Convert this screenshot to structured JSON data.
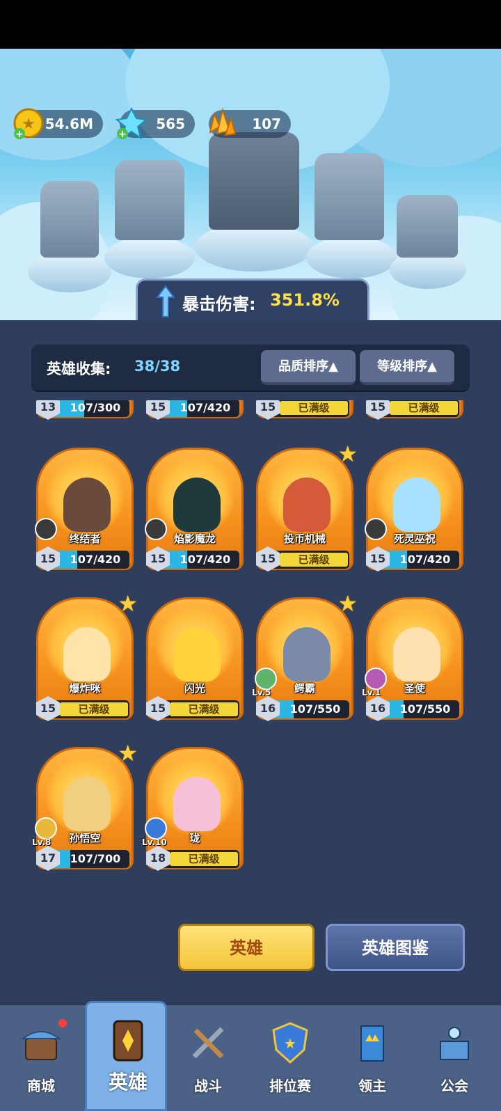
{
  "resources": {
    "gold": "54.6M",
    "crystal": "565",
    "gem": "107"
  },
  "crit": {
    "label": "暴击伤害:",
    "value": "351.8%"
  },
  "collection": {
    "label": "英雄收集:",
    "count": "38/38",
    "sort_quality": "品质排序▲",
    "sort_level": "等级排序▲"
  },
  "partial_row": [
    {
      "level": "13",
      "progress": "107/300",
      "fill": 0.36
    },
    {
      "level": "15",
      "progress": "107/420",
      "fill": 0.25
    },
    {
      "level": "15",
      "progress": "已满级",
      "maxed": true
    },
    {
      "level": "15",
      "progress": "已满级",
      "maxed": true
    }
  ],
  "heroes": [
    {
      "name": "终结者",
      "level": "15",
      "progress": "107/420",
      "fill": 0.25,
      "star": false,
      "pet_level": "",
      "color": "#6a4a3a",
      "pet_color": "#3a3a3a"
    },
    {
      "name": "焰影魔龙",
      "level": "15",
      "progress": "107/420",
      "fill": 0.25,
      "star": false,
      "pet_level": "",
      "color": "#1e3a3a",
      "pet_color": "#3a3a3a"
    },
    {
      "name": "投币机械",
      "level": "15",
      "progress": "已满级",
      "maxed": true,
      "star": true,
      "pet_level": "",
      "color": "#d45a3a",
      "pet_color": ""
    },
    {
      "name": "死灵巫祝",
      "level": "15",
      "progress": "107/420",
      "fill": 0.25,
      "star": false,
      "pet_level": "",
      "color": "#a8e0ff",
      "pet_color": "#3a3a3a"
    },
    {
      "name": "爆炸咪",
      "level": "15",
      "progress": "已满级",
      "maxed": true,
      "star": true,
      "pet_level": "",
      "color": "#ffe3a8",
      "pet_color": ""
    },
    {
      "name": "闪光",
      "level": "15",
      "progress": "已满级",
      "maxed": true,
      "star": false,
      "pet_level": "",
      "color": "#ffd23c",
      "pet_color": ""
    },
    {
      "name": "鳄霸",
      "level": "16",
      "progress": "107/550",
      "fill": 0.2,
      "star": true,
      "pet_level": "Lv.5",
      "color": "#7a8aa8",
      "pet_color": "#5fb36a"
    },
    {
      "name": "圣使",
      "level": "16",
      "progress": "107/550",
      "fill": 0.2,
      "star": false,
      "pet_level": "Lv.1",
      "color": "#ffe0b0",
      "pet_color": "#b55ab3"
    },
    {
      "name": "孙悟空",
      "level": "17",
      "progress": "107/700",
      "fill": 0.15,
      "star": true,
      "pet_level": "Lv.8",
      "color": "#f0d080",
      "pet_color": "#e8b83a"
    },
    {
      "name": "珑",
      "level": "18",
      "progress": "已满级",
      "maxed": true,
      "star": false,
      "pet_level": "Lv.10",
      "color": "#f5c0d8",
      "pet_color": "#3a7ad8"
    }
  ],
  "buttons": {
    "heroes": "英雄",
    "codex": "英雄图鉴"
  },
  "nav": [
    {
      "label": "商城",
      "icon": "shop-icon",
      "active": false
    },
    {
      "label": "英雄",
      "icon": "hero-card-icon",
      "active": true
    },
    {
      "label": "战斗",
      "icon": "battle-swords-icon",
      "active": false
    },
    {
      "label": "排位赛",
      "icon": "ranked-shield-icon",
      "active": false
    },
    {
      "label": "领主",
      "icon": "lord-banner-icon",
      "active": false
    },
    {
      "label": "公会",
      "icon": "guild-castle-icon",
      "active": false
    }
  ],
  "colors": {
    "panel_bg": "#2f3e5c",
    "accent_yellow": "#ffe04a",
    "card_orange": "#f6921d",
    "maxed_yellow": "#f3d73a",
    "progress_blue": "#2ab7e6"
  }
}
